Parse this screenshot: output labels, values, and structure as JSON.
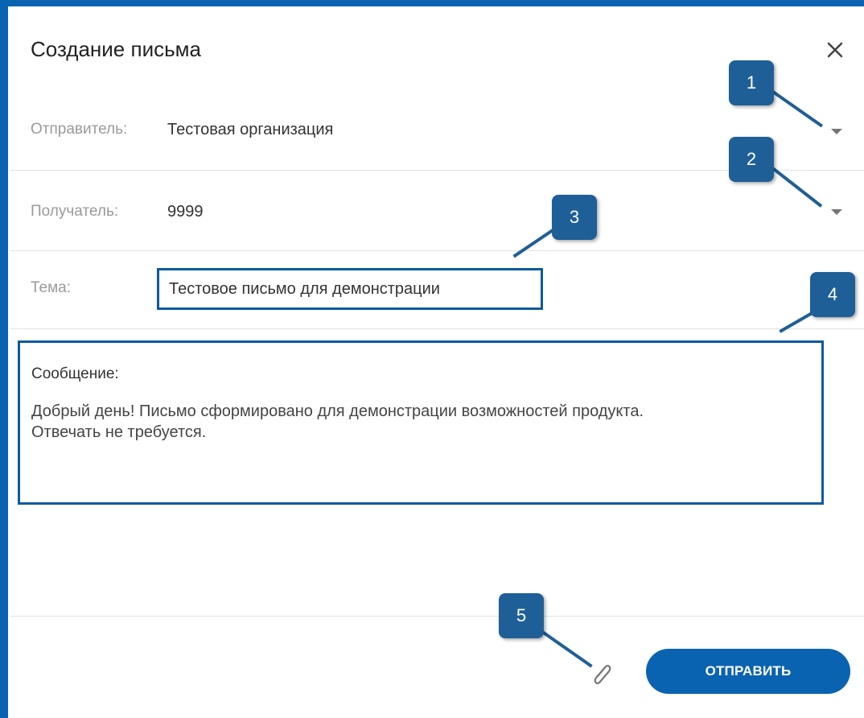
{
  "dialog": {
    "title": "Создание письма",
    "close_icon": "close-icon"
  },
  "fields": {
    "sender": {
      "label": "Отправитель:",
      "value": "Тестовая организация"
    },
    "recipient": {
      "label": "Получатель:",
      "value": "9999"
    },
    "subject": {
      "label": "Тема:",
      "value": "Тестовое письмо для демонстрации"
    }
  },
  "message": {
    "label": "Сообщение:",
    "body_line1": "Добрый день! Письмо сформировано для демонстрации возможностей продукта.",
    "body_line2": "Отвечать не требуется."
  },
  "actions": {
    "send_label": "ОТПРАВИТЬ",
    "attach_icon": "paperclip-icon"
  },
  "callouts": [
    "1",
    "2",
    "3",
    "4",
    "5"
  ],
  "colors": {
    "accent": "#0a63b0",
    "callout": "#1f5f97",
    "label": "#9a9a9a"
  }
}
